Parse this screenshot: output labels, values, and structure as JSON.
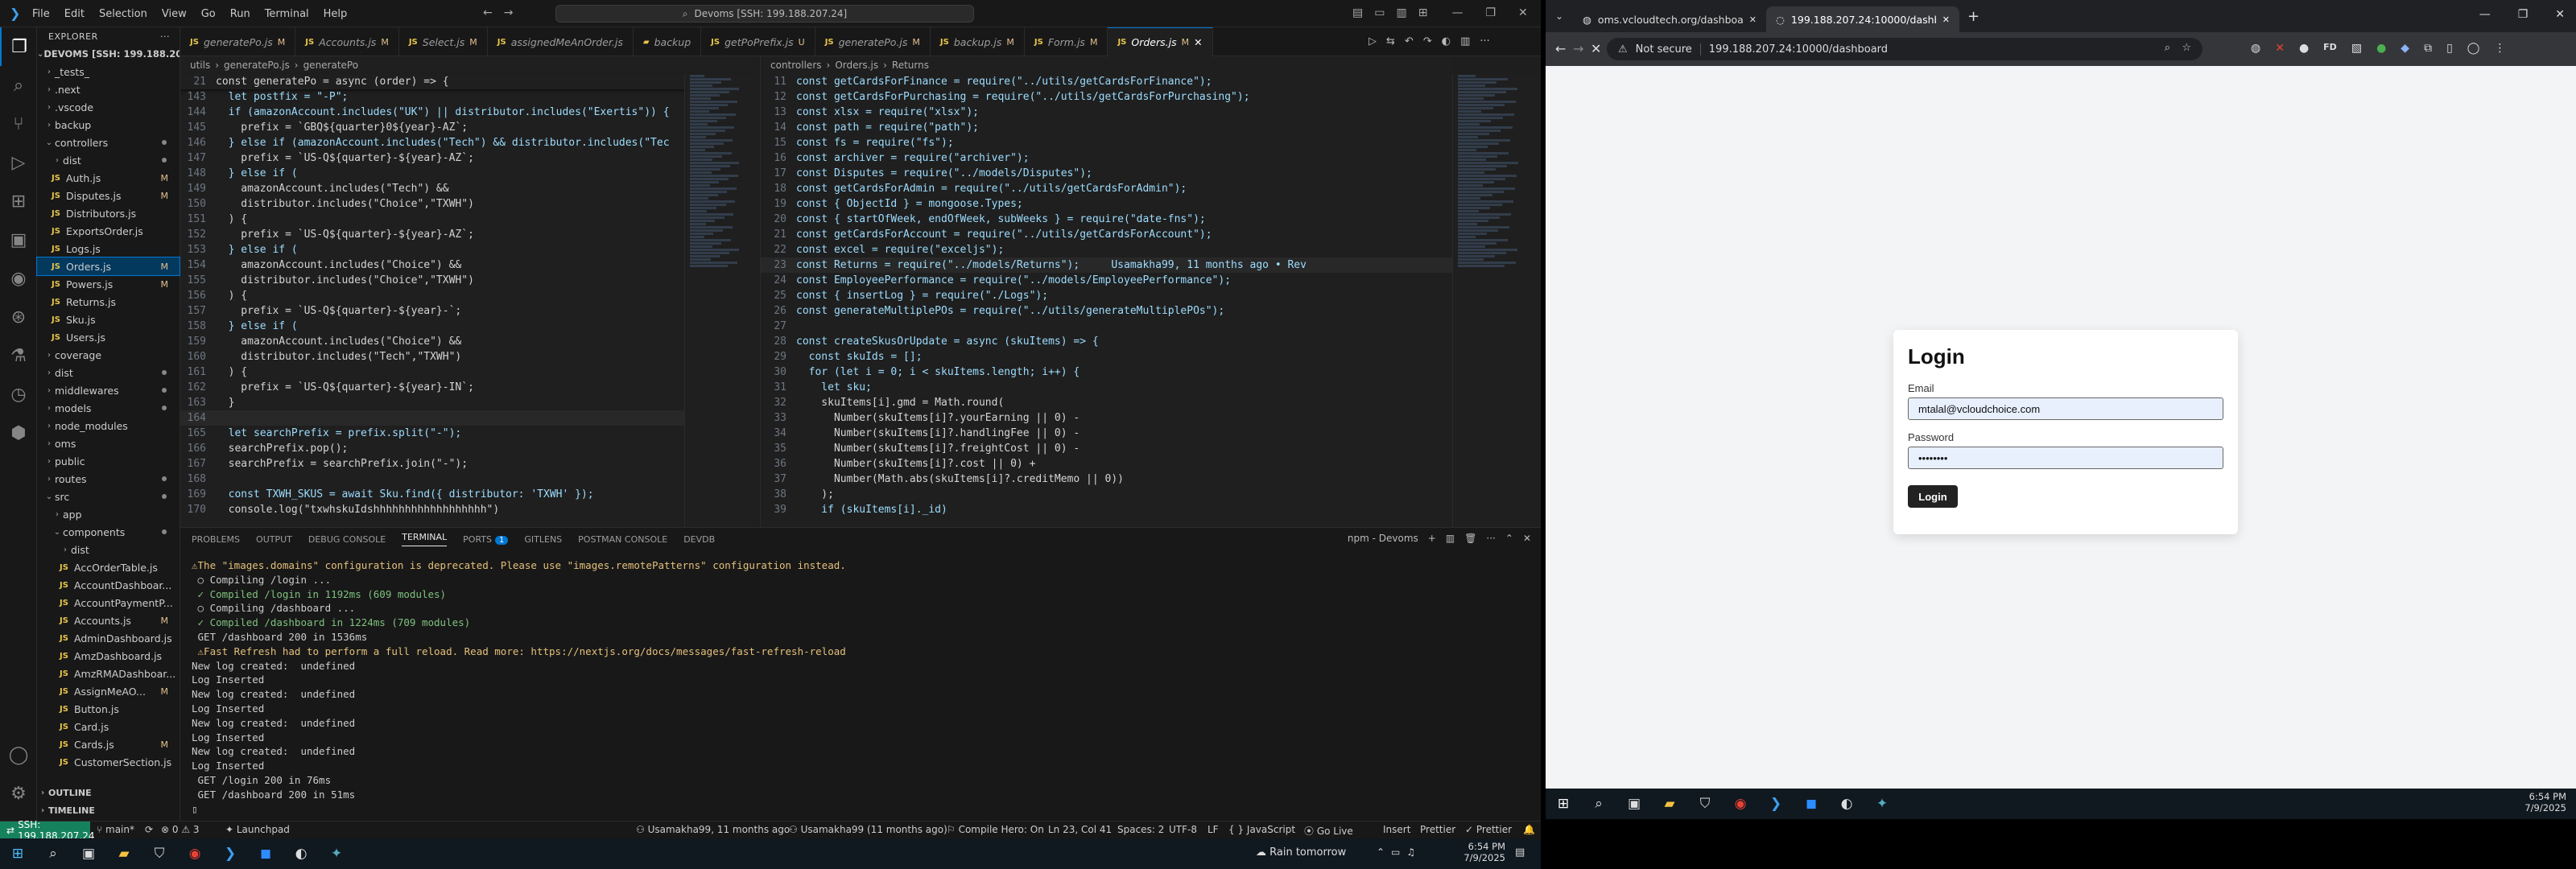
{
  "vscode": {
    "menu": [
      "File",
      "Edit",
      "Selection",
      "View",
      "Go",
      "Run",
      "Terminal",
      "Help"
    ],
    "command_center": "Devoms [SSH: 199.188.207.24]",
    "explorer_title": "EXPLORER",
    "workspace": "DEVOMS [SSH: 199.188.20...",
    "tree": [
      {
        "label": "_tests_",
        "kind": "folder",
        "indent": 1
      },
      {
        "label": ".next",
        "kind": "folder",
        "indent": 1
      },
      {
        "label": ".vscode",
        "kind": "folder",
        "indent": 1
      },
      {
        "label": "backup",
        "kind": "folder",
        "indent": 1
      },
      {
        "label": "controllers",
        "kind": "folder-open",
        "indent": 1,
        "dot": true
      },
      {
        "label": "dist",
        "kind": "folder",
        "indent": 2,
        "dot": true
      },
      {
        "label": "Auth.js",
        "kind": "js",
        "indent": 2,
        "mark": "M"
      },
      {
        "label": "Disputes.js",
        "kind": "js",
        "indent": 2,
        "mark": "M"
      },
      {
        "label": "Distributors.js",
        "kind": "js",
        "indent": 2
      },
      {
        "label": "ExportsOrder.js",
        "kind": "js",
        "indent": 2
      },
      {
        "label": "Logs.js",
        "kind": "js",
        "indent": 2
      },
      {
        "label": "Orders.js",
        "kind": "js",
        "indent": 2,
        "mark": "M",
        "selected": true
      },
      {
        "label": "Powers.js",
        "kind": "js",
        "indent": 2,
        "mark": "M"
      },
      {
        "label": "Returns.js",
        "kind": "js",
        "indent": 2
      },
      {
        "label": "Sku.js",
        "kind": "js",
        "indent": 2
      },
      {
        "label": "Users.js",
        "kind": "js",
        "indent": 2
      },
      {
        "label": "coverage",
        "kind": "folder",
        "indent": 1
      },
      {
        "label": "dist",
        "kind": "folder",
        "indent": 1,
        "dot": true
      },
      {
        "label": "middlewares",
        "kind": "folder",
        "indent": 1,
        "dot": true
      },
      {
        "label": "models",
        "kind": "folder",
        "indent": 1,
        "dot": true
      },
      {
        "label": "node_modules",
        "kind": "folder",
        "indent": 1
      },
      {
        "label": "oms",
        "kind": "folder",
        "indent": 1
      },
      {
        "label": "public",
        "kind": "folder",
        "indent": 1
      },
      {
        "label": "routes",
        "kind": "folder",
        "indent": 1,
        "dot": true
      },
      {
        "label": "src",
        "kind": "folder-open",
        "indent": 1,
        "dot": true
      },
      {
        "label": "app",
        "kind": "folder",
        "indent": 2
      },
      {
        "label": "components",
        "kind": "folder-open",
        "indent": 2,
        "dot": true
      },
      {
        "label": "dist",
        "kind": "folder",
        "indent": 3
      },
      {
        "label": "AccOrderTable.js",
        "kind": "js",
        "indent": 3
      },
      {
        "label": "AccountDashboar...",
        "kind": "js",
        "indent": 3
      },
      {
        "label": "AccountPaymentP...",
        "kind": "js",
        "indent": 3
      },
      {
        "label": "Accounts.js",
        "kind": "js",
        "indent": 3,
        "mark": "M"
      },
      {
        "label": "AdminDashboard.js",
        "kind": "js",
        "indent": 3
      },
      {
        "label": "AmzDashboard.js",
        "kind": "js",
        "indent": 3
      },
      {
        "label": "AmzRMADashboar...",
        "kind": "js",
        "indent": 3
      },
      {
        "label": "AssignMeAO...",
        "kind": "js",
        "indent": 3,
        "mark": "M"
      },
      {
        "label": "Button.js",
        "kind": "js",
        "indent": 3
      },
      {
        "label": "Card.js",
        "kind": "js",
        "indent": 3
      },
      {
        "label": "Cards.js",
        "kind": "js",
        "indent": 3,
        "mark": "M"
      },
      {
        "label": "CustomerSection.js",
        "kind": "js",
        "indent": 3
      }
    ],
    "outline": "OUTLINE",
    "timeline": "TIMELINE",
    "tabs": [
      {
        "label": "generatePo.js",
        "mark": "M"
      },
      {
        "label": "Accounts.js",
        "mark": "M"
      },
      {
        "label": "Select.js",
        "mark": "M"
      },
      {
        "label": "assignedMeAnOrder.js",
        "mark": ""
      },
      {
        "label": "backup",
        "mark": "",
        "folder": true
      },
      {
        "label": "getPoPrefix.js",
        "mark": "U"
      },
      {
        "label": "generatePo.js",
        "mark": "M"
      },
      {
        "label": "backup.js",
        "mark": "M"
      },
      {
        "label": "Form.js",
        "mark": "M"
      },
      {
        "label": "Orders.js",
        "mark": "M",
        "active": true
      }
    ],
    "left_crumb": [
      "utils",
      "generatePo.js",
      "generatePo"
    ],
    "left_sticky": {
      "ln": "21",
      "code": "const generatePo = async (order) => {"
    },
    "left_code": [
      {
        "ln": "143",
        "code": "  let postfix = \"-P\";"
      },
      {
        "ln": "144",
        "code": "  if (amazonAccount.includes(\"UK\") || distributor.includes(\"Exertis\")) {"
      },
      {
        "ln": "145",
        "code": "    prefix = `GBQ${quarter}0${year}-AZ`;"
      },
      {
        "ln": "146",
        "code": "  } else if (amazonAccount.includes(\"Tech\") && distributor.includes(\"Tec"
      },
      {
        "ln": "147",
        "code": "    prefix = `US-Q${quarter}-${year}-AZ`;"
      },
      {
        "ln": "148",
        "code": "  } else if ("
      },
      {
        "ln": "149",
        "code": "    amazonAccount.includes(\"Tech\") &&"
      },
      {
        "ln": "150",
        "code": "    distributor.includes(\"Choice\",\"TXWH\")"
      },
      {
        "ln": "151",
        "code": "  ) {"
      },
      {
        "ln": "152",
        "code": "    prefix = `US-Q${quarter}-${year}-AZ`;"
      },
      {
        "ln": "153",
        "code": "  } else if ("
      },
      {
        "ln": "154",
        "code": "    amazonAccount.includes(\"Choice\") &&"
      },
      {
        "ln": "155",
        "code": "    distributor.includes(\"Choice\",\"TXWH\")"
      },
      {
        "ln": "156",
        "code": "  ) {"
      },
      {
        "ln": "157",
        "code": "    prefix = `US-Q${quarter}-${year}-`;"
      },
      {
        "ln": "158",
        "code": "  } else if ("
      },
      {
        "ln": "159",
        "code": "    amazonAccount.includes(\"Choice\") &&"
      },
      {
        "ln": "160",
        "code": "    distributor.includes(\"Tech\",\"TXWH\")"
      },
      {
        "ln": "161",
        "code": "  ) {"
      },
      {
        "ln": "162",
        "code": "    prefix = `US-Q${quarter}-${year}-IN`;"
      },
      {
        "ln": "163",
        "code": "  }"
      },
      {
        "ln": "164",
        "code": ""
      },
      {
        "ln": "165",
        "code": "  let searchPrefix = prefix.split(\"-\");"
      },
      {
        "ln": "166",
        "code": "  searchPrefix.pop();"
      },
      {
        "ln": "167",
        "code": "  searchPrefix = searchPrefix.join(\"-\");"
      },
      {
        "ln": "168",
        "code": ""
      },
      {
        "ln": "169",
        "code": "  const TXWH_SKUS = await Sku.find({ distributor: 'TXWH' });"
      },
      {
        "ln": "170",
        "code": "  console.log(\"txwhskuIdshhhhhhhhhhhhhhhhhh\")"
      }
    ],
    "right_crumb": [
      "controllers",
      "Orders.js",
      "Returns"
    ],
    "right_code": [
      {
        "ln": "11",
        "code": "const getCardsForFinance = require(\"../utils/getCardsForFinance\");"
      },
      {
        "ln": "12",
        "code": "const getCardsForPurchasing = require(\"../utils/getCardsForPurchasing\");"
      },
      {
        "ln": "13",
        "code": "const xlsx = require(\"xlsx\");"
      },
      {
        "ln": "14",
        "code": "const path = require(\"path\");"
      },
      {
        "ln": "15",
        "code": "const fs = require(\"fs\");"
      },
      {
        "ln": "16",
        "code": "const archiver = require(\"archiver\");"
      },
      {
        "ln": "17",
        "code": "const Disputes = require(\"../models/Disputes\");"
      },
      {
        "ln": "18",
        "code": "const getCardsForAdmin = require(\"../utils/getCardsForAdmin\");"
      },
      {
        "ln": "19",
        "code": "const { ObjectId } = mongoose.Types;"
      },
      {
        "ln": "20",
        "code": "const { startOfWeek, endOfWeek, subWeeks } = require(\"date-fns\");"
      },
      {
        "ln": "21",
        "code": "const getCardsForAccount = require(\"../utils/getCardsForAccount\");"
      },
      {
        "ln": "22",
        "code": "const excel = require(\"exceljs\");"
      },
      {
        "ln": "23",
        "code": "const Returns = require(\"../models/Returns\");     Usamakha99, 11 months ago • Rev"
      },
      {
        "ln": "24",
        "code": "const EmployeePerformance = require(\"../models/EmployeePerformance\");"
      },
      {
        "ln": "25",
        "code": "const { insertLog } = require(\"./Logs\");"
      },
      {
        "ln": "26",
        "code": "const generateMultiplePOs = require(\"../utils/generateMultiplePOs\");"
      },
      {
        "ln": "27",
        "code": ""
      },
      {
        "ln": "28",
        "code": "const createSkusOrUpdate = async (skuItems) => {"
      },
      {
        "ln": "29",
        "code": "  const skuIds = [];"
      },
      {
        "ln": "30",
        "code": "  for (let i = 0; i < skuItems.length; i++) {"
      },
      {
        "ln": "31",
        "code": "    let sku;"
      },
      {
        "ln": "32",
        "code": "    skuItems[i].gmd = Math.round("
      },
      {
        "ln": "33",
        "code": "      Number(skuItems[i]?.yourEarning || 0) -"
      },
      {
        "ln": "34",
        "code": "      Number(skuItems[i]?.handlingFee || 0) -"
      },
      {
        "ln": "35",
        "code": "      Number(skuItems[i]?.freightCost || 0) -"
      },
      {
        "ln": "36",
        "code": "      Number(skuItems[i]?.cost || 0) +"
      },
      {
        "ln": "37",
        "code": "      Number(Math.abs(skuItems[i]?.creditMemo || 0))"
      },
      {
        "ln": "38",
        "code": "    );"
      },
      {
        "ln": "39",
        "code": "    if (skuItems[i]._id)"
      }
    ],
    "panel_tabs": [
      "PROBLEMS",
      "OUTPUT",
      "DEBUG CONSOLE",
      "TERMINAL",
      "PORTS",
      "GITLENS",
      "POSTMAN CONSOLE",
      "DEVDB"
    ],
    "ports_badge": "1",
    "terminal_name": "npm - Devoms",
    "terminal": [
      {
        "text": "⚠The \"images.domains\" configuration is deprecated. Please use \"images.remotePatterns\" configuration instead.",
        "cls": "w"
      },
      {
        "text": " ○ Compiling /login ...",
        "cls": ""
      },
      {
        "text": " ✓ Compiled /login in 1192ms (609 modules)",
        "cls": "g"
      },
      {
        "text": " ○ Compiling /dashboard ...",
        "cls": ""
      },
      {
        "text": " ✓ Compiled /dashboard in 1224ms (709 modules)",
        "cls": "g"
      },
      {
        "text": " GET /dashboard 200 in 1536ms",
        "cls": ""
      },
      {
        "text": " ⚠Fast Refresh had to perform a full reload. Read more: https://nextjs.org/docs/messages/fast-refresh-reload",
        "cls": "w"
      },
      {
        "text": "New log created:  undefined",
        "cls": ""
      },
      {
        "text": "Log Inserted",
        "cls": ""
      },
      {
        "text": "New log created:  undefined",
        "cls": ""
      },
      {
        "text": "Log Inserted",
        "cls": ""
      },
      {
        "text": "New log created:  undefined",
        "cls": ""
      },
      {
        "text": "Log Inserted",
        "cls": ""
      },
      {
        "text": "New log created:  undefined",
        "cls": ""
      },
      {
        "text": "Log Inserted",
        "cls": ""
      },
      {
        "text": " GET /login 200 in 76ms",
        "cls": ""
      },
      {
        "text": " GET /dashboard 200 in 51ms",
        "cls": ""
      },
      {
        "text": "▯",
        "cls": ""
      }
    ],
    "status": {
      "ssh": "SSH: 199.188.207.24",
      "branch": "main*",
      "errors": "⊗ 0  ⚠ 3",
      "launchpad": "Launchpad",
      "blame": "Usamakha99, 11 months ago",
      "blame2": "Usamakha99 (11 months ago)",
      "compile": "Compile Hero: On",
      "position": "Ln 23, Col 41",
      "spaces": "Spaces: 2",
      "encoding": "UTF-8",
      "eol": "LF",
      "language": "{ } JavaScript",
      "golive": "Go Live",
      "insert": "Insert",
      "prettier1": "Prettier",
      "prettier2": "Prettier"
    },
    "taskbar": {
      "weather": "Rain tomorrow"
    }
  },
  "chrome": {
    "tabs": [
      {
        "label": "oms.vcloudtech.org/dashboard",
        "active": false
      },
      {
        "label": "199.188.207.24:10000/dashboard",
        "active": true
      }
    ],
    "not_secure": "Not secure",
    "url": "199.188.207.24:10000/dashboard",
    "login": {
      "title": "Login",
      "email_label": "Email",
      "email_value": "mtalal@vcloudchoice.com",
      "password_label": "Password",
      "password_value": "••••••••",
      "button": "Login"
    }
  },
  "clock": {
    "left_time": "6:54 PM",
    "left_date": "7/9/2025",
    "right_time": "6:54 PM",
    "right_date": "7/9/2025"
  }
}
